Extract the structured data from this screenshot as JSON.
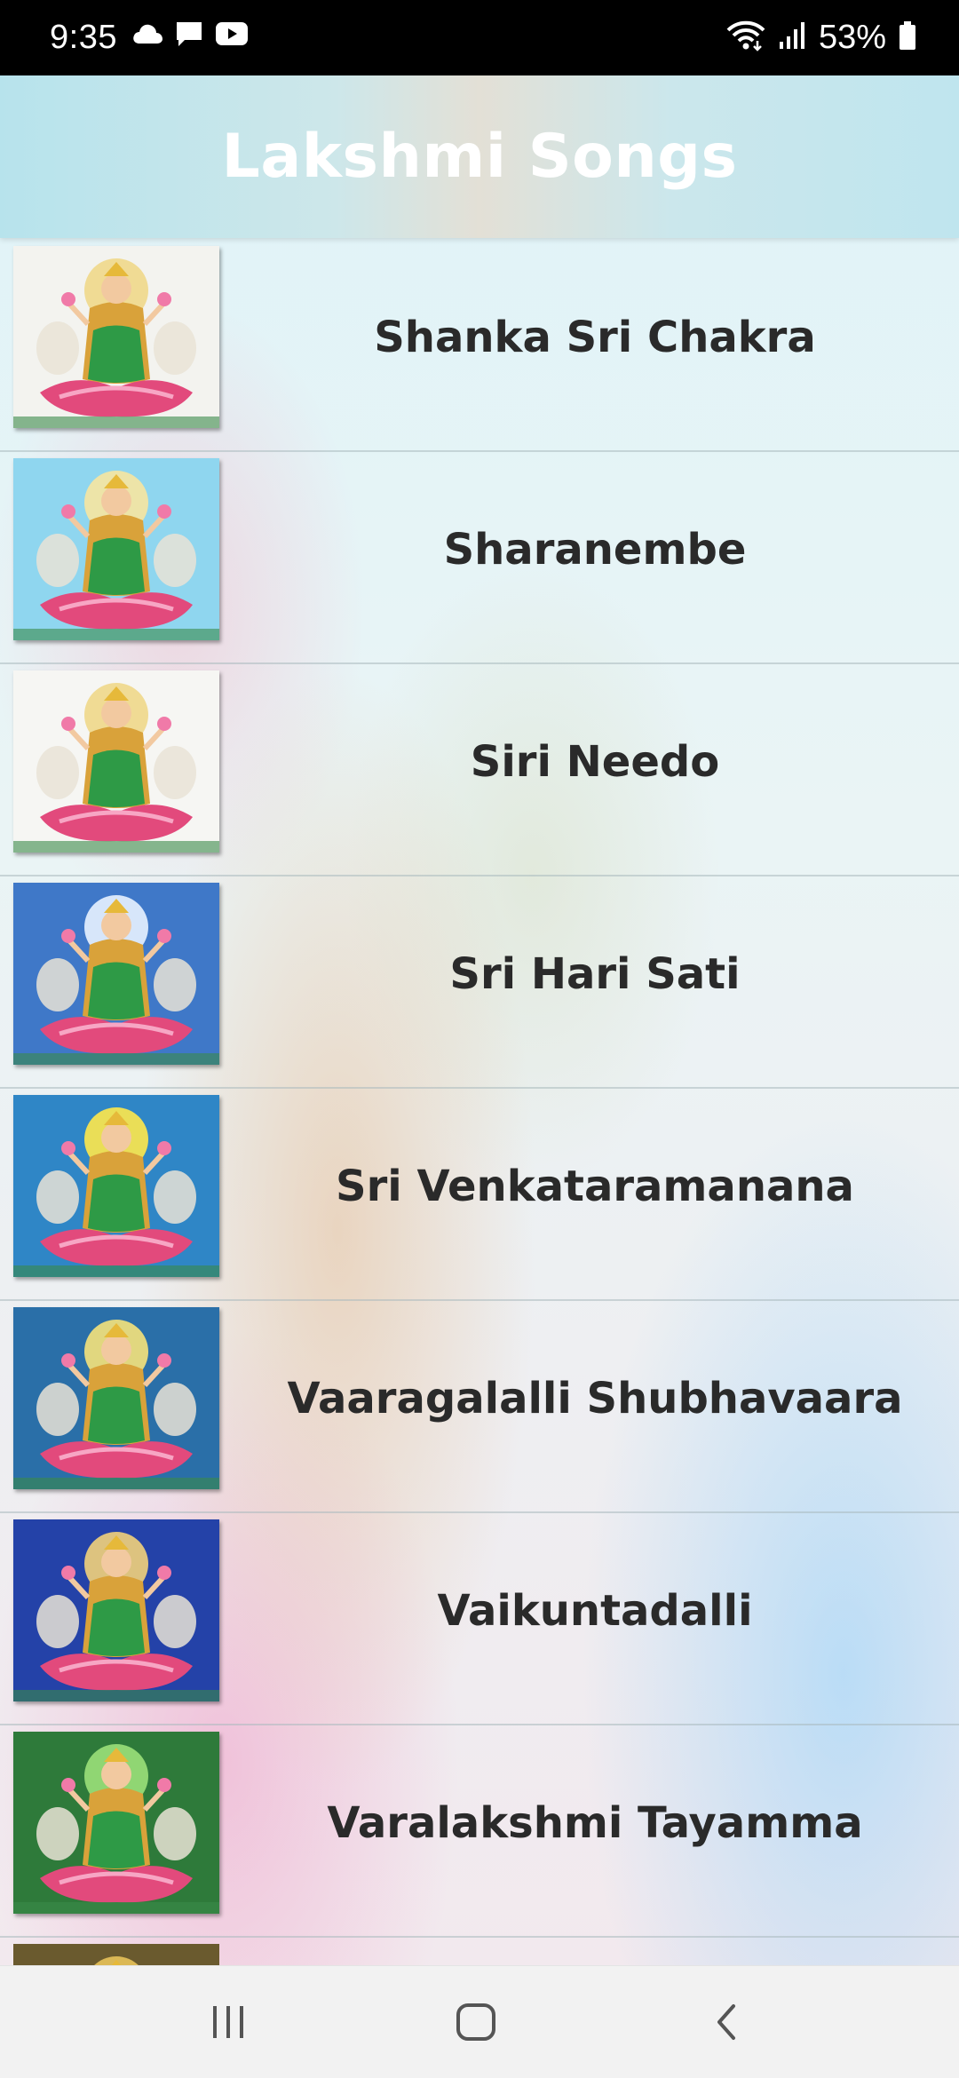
{
  "status_bar": {
    "time": "9:35",
    "battery_percent": "53%",
    "notification_icons": [
      "cloud-icon",
      "message-icon",
      "youtube-icon"
    ],
    "system_icons": [
      "wifi-icon",
      "signal-icon",
      "battery-icon"
    ]
  },
  "app": {
    "title": "Lakshmi Songs",
    "colors": {
      "title_text": "#ffffff",
      "song_text": "#2a2a2a",
      "header_tint": "#b7e3ec"
    }
  },
  "songs": [
    {
      "title": "Shanka Sri Chakra",
      "thumb_bg": "#f3f3ef",
      "thumb_halo": "#f0d88a"
    },
    {
      "title": "Sharanembe",
      "thumb_bg": "#8fd6ef",
      "thumb_halo": "#f7e6a0"
    },
    {
      "title": "Siri Needo",
      "thumb_bg": "#f6f6f3",
      "thumb_halo": "#f0d88a"
    },
    {
      "title": "Sri Hari Sati",
      "thumb_bg": "#3f78c8",
      "thumb_halo": "#e8f2ff"
    },
    {
      "title": "Sri Venkataramanana",
      "thumb_bg": "#2f86c6",
      "thumb_halo": "#ffe84a"
    },
    {
      "title": "Vaaragalalli Shubhavaara",
      "thumb_bg": "#2a6fa8",
      "thumb_halo": "#f5e27a"
    },
    {
      "title": "Vaikuntadalli",
      "thumb_bg": "#2442a8",
      "thumb_halo": "#f2d27a"
    },
    {
      "title": "Varalakshmi Tayamma",
      "thumb_bg": "#2e7a3a",
      "thumb_halo": "#9be07a"
    }
  ],
  "navigation": {
    "buttons": [
      "recent-apps-icon",
      "home-icon",
      "back-icon"
    ]
  }
}
